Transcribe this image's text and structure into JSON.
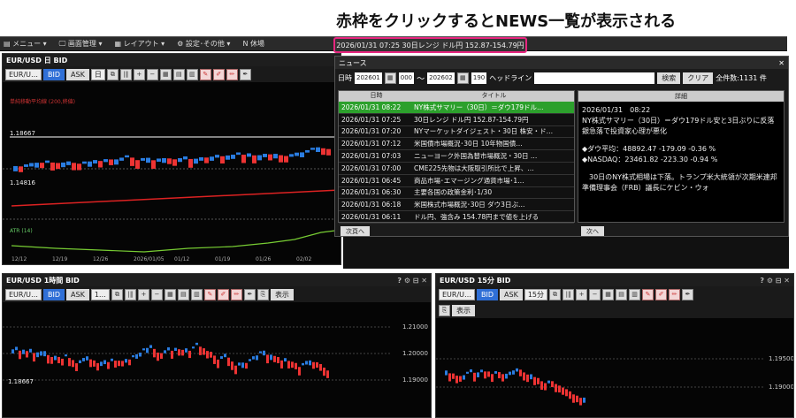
{
  "caption": "赤枠をクリックするとNEWS一覧が表示される",
  "menubar": {
    "items": [
      "▤ メニュー ▾",
      "🖵 画面管理 ▾",
      "▦ レイアウト ▾",
      "⚙ 設定･その他 ▾",
      "N 休場"
    ]
  },
  "ticker": "2026/01/31 07:25  30日レンジ  ドル円 152.87-154.79円",
  "daily": {
    "title": "EUR/USD 日 BID",
    "sym": "EUR/U…",
    "bid": "BID",
    "ask": "ASK",
    "tf": "日",
    "price1": "1.18667",
    "price2": "1.14816",
    "ma": "単純移動平均線 (200,終値)",
    "atr": "ATR (14)",
    "dates": [
      "12/12",
      "12/19",
      "12/26",
      "2026/01/05",
      "01/12",
      "01/19",
      "01/26",
      "02/02"
    ]
  },
  "hourly": {
    "title": "EUR/USD 1時間 BID",
    "sym": "EUR/U…",
    "bid": "BID",
    "ask": "ASK",
    "tf": "1…",
    "display": "表示",
    "prices": [
      "1.21000",
      "1.20000",
      "1.19000"
    ],
    "left": "1.18667"
  },
  "m15": {
    "title": "EUR/USD 15分 BID",
    "sym": "EUR/U…",
    "bid": "BID",
    "ask": "ASK",
    "tf": "15分",
    "display": "表示",
    "prices": [
      "1.19500",
      "1.19000"
    ]
  },
  "news": {
    "title": "ニュース",
    "date_label": "日時",
    "from": "202601",
    "to": "202602",
    "t1": "000",
    "t2": "190",
    "headline_label": "ヘッドライン",
    "search": "検索",
    "clear": "クリア",
    "count": "全件数:1131 件",
    "col_time": "日時",
    "col_title": "タイトル",
    "col_detail": "詳細",
    "rows": [
      {
        "d": "2026/01/31",
        "t": "08:22",
        "title": "NY株式サマリー（30日）＝ダウ179ドル…"
      },
      {
        "d": "2026/01/31",
        "t": "07:25",
        "title": "30日レンジ ドル円 152.87-154.79円"
      },
      {
        "d": "2026/01/31",
        "t": "07:20",
        "title": "NYマーケットダイジェスト・30日 株安・ド…"
      },
      {
        "d": "2026/01/31",
        "t": "07:12",
        "title": "米国債市場概況･30日 10年物国債…"
      },
      {
        "d": "2026/01/31",
        "t": "07:03",
        "title": "ニューヨーク外国為替市場概況・30日 …"
      },
      {
        "d": "2026/01/31",
        "t": "07:00",
        "title": "CME225先物は大阪取引所比で上昇、…"
      },
      {
        "d": "2026/01/31",
        "t": "06:45",
        "title": "商品市場･エマージング通貨市場･1…"
      },
      {
        "d": "2026/01/31",
        "t": "06:30",
        "title": "主要各国の政策金利･1/30"
      },
      {
        "d": "2026/01/31",
        "t": "06:18",
        "title": "米国株式市場概況･30日 ダウ3日ぶ…"
      },
      {
        "d": "2026/01/31",
        "t": "06:11",
        "title": "ドル円、強含み 154.78円まで値を上げる"
      }
    ],
    "detail_lines": [
      "2026/01/31　08:22",
      "NY株式サマリー（30日）＝ダウ179ドル安と3日ぶりに反落　銀急落で投資家心理が悪化",
      "",
      "◆ダウ平均：48892.47 -179.09 -0.36 %",
      "◆NASDAQ：23461.82 -223.30 -0.94 %",
      "",
      "　30日のNY株式相場は下落。トランプ米大統領が次期米連邦準備理事会（FRB）議長にケビン・ウォ"
    ],
    "prev": "次頁へ",
    "next": "次へ"
  }
}
